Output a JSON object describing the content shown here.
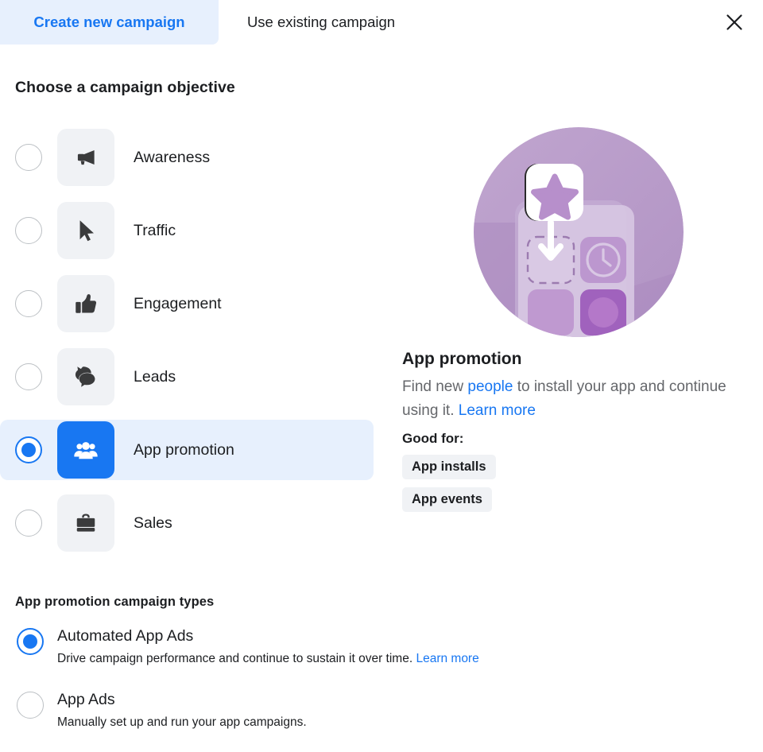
{
  "tabs": [
    {
      "label": "Create new campaign",
      "active": true
    },
    {
      "label": "Use existing campaign",
      "active": false
    }
  ],
  "close_label": "Close",
  "headings": {
    "objective": "Choose a campaign objective",
    "campaign_types": "App promotion campaign types"
  },
  "objectives": [
    {
      "label": "Awareness",
      "icon": "megaphone-icon",
      "selected": false
    },
    {
      "label": "Traffic",
      "icon": "cursor-icon",
      "selected": false
    },
    {
      "label": "Engagement",
      "icon": "thumbs-up-icon",
      "selected": false
    },
    {
      "label": "Leads",
      "icon": "chat-bubbles-icon",
      "selected": false
    },
    {
      "label": "App promotion",
      "icon": "people-group-icon",
      "selected": true
    },
    {
      "label": "Sales",
      "icon": "briefcase-icon",
      "selected": false
    }
  ],
  "detail": {
    "illustration": "app-promotion-illustration",
    "title": "App promotion",
    "desc_part1": "Find new ",
    "desc_link1": "people",
    "desc_part2": " to install your app and continue using it. ",
    "desc_link2": "Learn more",
    "good_for_label": "Good for:",
    "chips": [
      "App installs",
      "App events"
    ]
  },
  "campaign_types": [
    {
      "name": "Automated App Ads",
      "desc": "Drive campaign performance and continue to sustain it over time. ",
      "link": "Learn more",
      "selected": true
    },
    {
      "name": "App Ads",
      "desc": "Manually set up and run your app campaigns.",
      "link": "",
      "selected": false
    }
  ],
  "colors": {
    "accent": "#1877f2",
    "selected_row_bg": "#e7f0fd",
    "tile_bg": "#f0f2f5",
    "text_primary": "#1c1e21",
    "text_secondary": "#65676b",
    "illustration_purple": "#b99bc9"
  }
}
